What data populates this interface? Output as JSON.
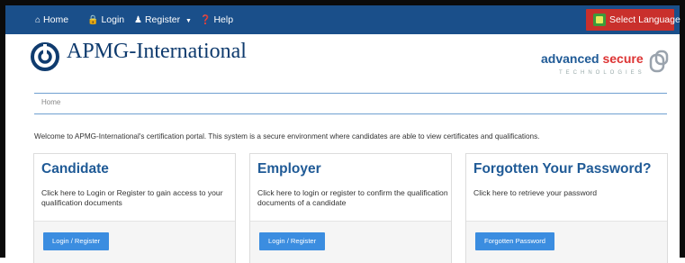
{
  "nav": {
    "items": [
      {
        "label": "Home",
        "icon": "home-icon"
      },
      {
        "label": "Login",
        "icon": "lock-icon"
      },
      {
        "label": "Register",
        "icon": "user-icon"
      },
      {
        "label": "Help",
        "icon": "question-circle-icon"
      }
    ],
    "language_button": "Select Language"
  },
  "brand": {
    "name": "APMG-International",
    "partner_logo_word_1": "advanced",
    "partner_logo_word_2": "secure",
    "partner_logo_sub": "TECHNOLOGIES"
  },
  "breadcrumb": {
    "current": "Home"
  },
  "welcome_text": "Welcome to APMG-International's certification portal. This system is a secure environment where candidates are able to view certificates and qualifications.",
  "cards": [
    {
      "title": "Candidate",
      "text": "Click here to Login or Register to gain access to your qualification documents",
      "button": "Login / Register"
    },
    {
      "title": "Employer",
      "text": "Click here to login or register to confirm the qualification documents of a candidate",
      "button": "Login / Register"
    },
    {
      "title": "Forgotten Your Password?",
      "text": "Click here to retrieve your password",
      "button": "Forgotten Password"
    }
  ],
  "colors": {
    "navbar": "#1a4f8a",
    "language_button": "#c9302c",
    "heading": "#1f5a96",
    "button": "#3b8de0"
  }
}
